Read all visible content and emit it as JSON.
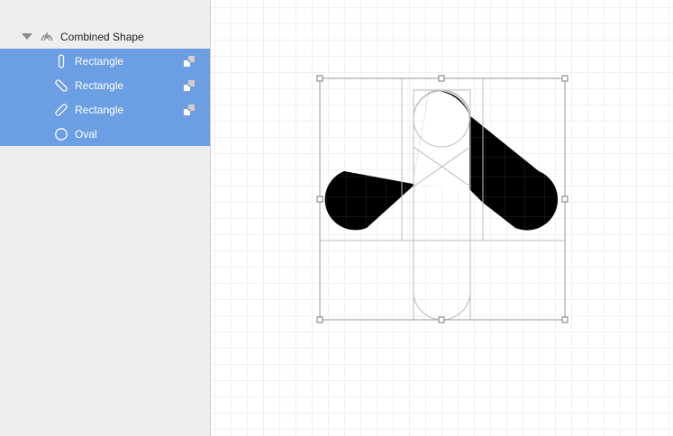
{
  "layers": {
    "group_label": "Combined Shape",
    "items": [
      {
        "label": "Rectangle",
        "icon": "vertical-rectangle-icon"
      },
      {
        "label": "Rectangle",
        "icon": "diagonal-rectangle-icon"
      },
      {
        "label": "Rectangle",
        "icon": "diagonal-rectangle-icon"
      },
      {
        "label": "Oval",
        "icon": "oval-icon"
      }
    ]
  },
  "colors": {
    "selection": "#6b9ee2",
    "sidebar": "#eeeeee",
    "shape_fill": "#000000"
  }
}
